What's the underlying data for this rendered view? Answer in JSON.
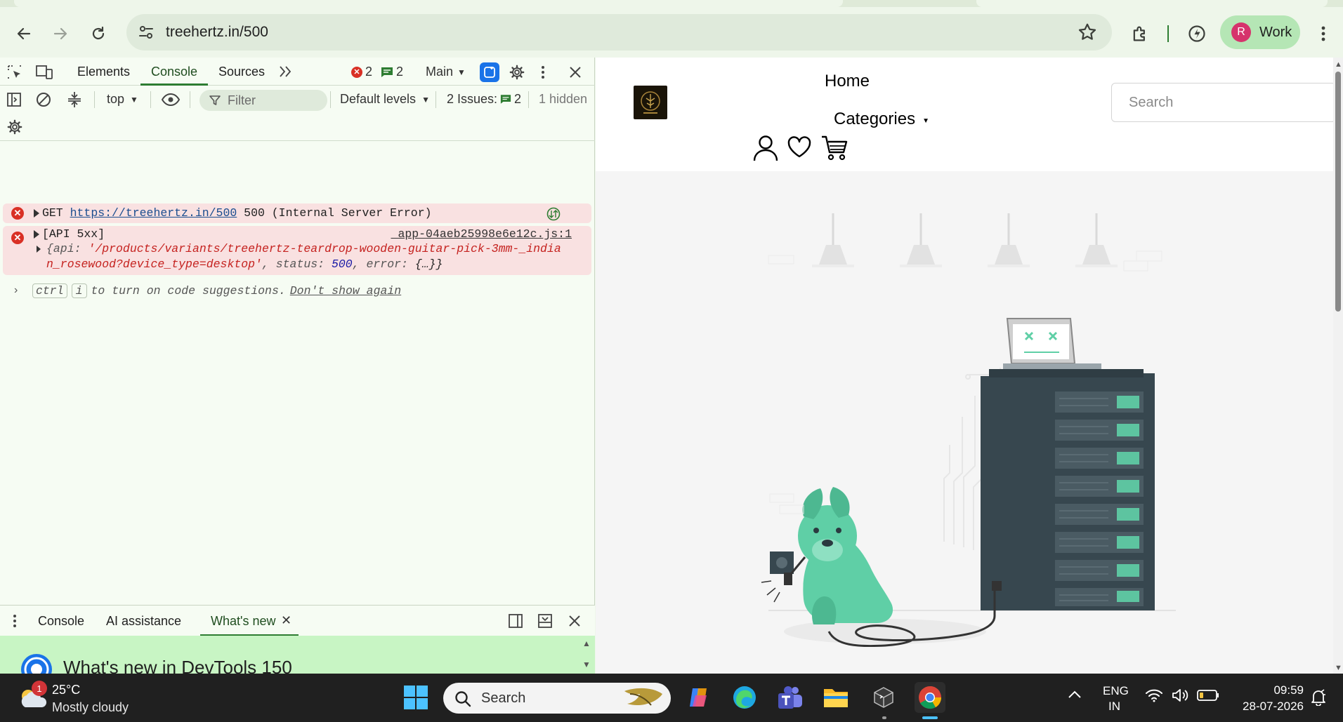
{
  "browser": {
    "url": "treehertz.in/500",
    "profile_initial": "R",
    "profile_label": "Work"
  },
  "devtools": {
    "tabs": [
      "Elements",
      "Console",
      "Sources"
    ],
    "error_count": "2",
    "message_count": "2",
    "context": "Main",
    "top_context": "top",
    "filter_placeholder": "Filter",
    "default_levels": "Default levels",
    "issues_label": "2 Issues:",
    "issues_count": "2",
    "hidden_label": "1 hidden",
    "log": {
      "row1_prefix": "GET",
      "row1_url": "https://treehertz.in/500",
      "row1_suffix": "500 (Internal Server Error)",
      "row2_label": "[API 5xx]",
      "row2_source": "_app-04aeb25998e6e12c.js:1",
      "row2_obj_open": "{api: ",
      "row2_api_line1": "'/products/variants/treehertz-teardrop-wooden-guitar-pick-3mm-_india",
      "row2_api_line2": "n_rosewood?device_type=desktop'",
      "row2_status_key": ", status: ",
      "row2_status_val": "500",
      "row2_error_key": ", error: ",
      "row2_error_val": "{…}}",
      "hint_key1": "ctrl",
      "hint_key2": "i",
      "hint_text": "to turn on code suggestions.",
      "hint_link": "Don't show again"
    },
    "drawer": {
      "tabs": [
        "Console",
        "AI assistance",
        "What's new"
      ],
      "whats_new_title": "What's new in DevTools 150"
    }
  },
  "webpage": {
    "nav_home": "Home",
    "nav_categories": "Categories",
    "search_placeholder": "Search"
  },
  "taskbar": {
    "weather_temp": "25°C",
    "weather_desc": "Mostly cloudy",
    "weather_badge": "1",
    "search_placeholder": "Search",
    "lang_top": "ENG",
    "lang_bottom": "IN",
    "time": "09:59",
    "date": "28-07-2026"
  },
  "colors": {
    "accent_green": "#2e7d32",
    "error_red": "#d93025",
    "illustration_teal": "#5fcfa6",
    "server_dark": "#37474f"
  }
}
